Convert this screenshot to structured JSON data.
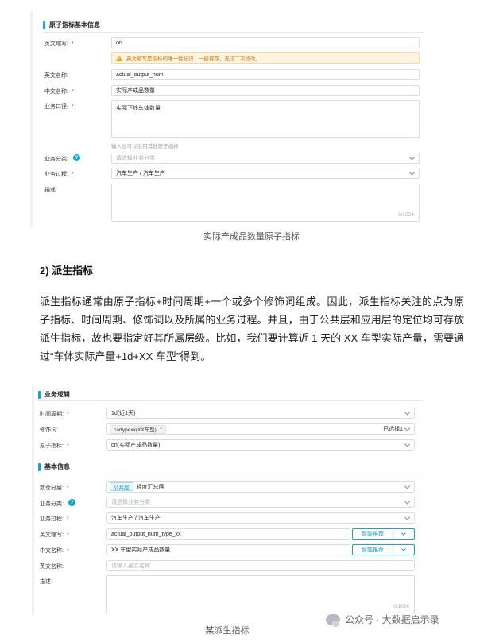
{
  "panel1": {
    "section_title": "原子指标基本信息",
    "abbr_label": "英文缩写:",
    "abbr_value": "on",
    "warning": "英文缩写是指标的唯一性标识，一经保存，无法二次修改。",
    "en_name_label": "英文名称:",
    "en_name_value": "actual_output_num",
    "cn_name_label": "中文名称:",
    "cn_name_value": "实际产成品数量",
    "caliber_label": "业务口径:",
    "caliber_value": "实际下线车体数量",
    "caliber_hint": "输入@可以引用其他原子指标",
    "category_label": "业务分类:",
    "category_placeholder": "请选择业务分类",
    "process_label": "业务过程:",
    "process_value": "汽车生产 / 汽车生产",
    "desc_label": "描述:",
    "desc_count": "0/1024"
  },
  "caption1": "实际产成品数量原子指标",
  "heading": "2)   派生指标",
  "paragraph": "派生指标通常由原子指标+时间周期+一个或多个修饰词组成。因此，派生指标关注的点为原子指标、时间周期、修饰词以及所属的业务过程。并且，由于公共层和应用层的定位均可存放派生指标，故也要指定好其所属层级。比如，我们要计算近 1 天的 XX 车型实际产量，需要通过“车体实际产量+1d+XX 车型”得到。",
  "panel2": {
    "logic_title": "业务逻辑",
    "period_label": "时间周期:",
    "period_value": "1d(近1天)",
    "modifier_label": "修饰词:",
    "modifier_tag": "cartypexx(XX车型)",
    "modifier_tag_close": "×",
    "modifier_count": "已选择1",
    "atomic_label": "原子指标:",
    "atomic_value": "on(实际产成品数量)",
    "basic_title": "基本信息",
    "layer_label": "数仓分层:",
    "layer_badge": "公共层",
    "layer_value": "轻度汇总层",
    "category_label": "业务分类:",
    "category_placeholder": "请选择业务分类",
    "process_label": "业务过程:",
    "process_value": "汽车生产 / 汽车生产",
    "abbr_label": "英文缩写:",
    "abbr_value": "actual_output_num_type_xx",
    "smart_label": "智能推荐",
    "cn_name_label": "中文名称:",
    "cn_name_value": "XX 车型实际产成品数量",
    "en_name_label": "英文名称:",
    "en_name_placeholder": "请输入英文名称",
    "desc_label": "描述:",
    "desc_count": "0/1024"
  },
  "caption2": "某派生指标",
  "watermark": "公众号 · 大数据启示录",
  "colors": {
    "accent": "#17a2c8",
    "required": "#e03030",
    "warning_bg": "#fff4e0",
    "warning_text": "#c77800"
  }
}
